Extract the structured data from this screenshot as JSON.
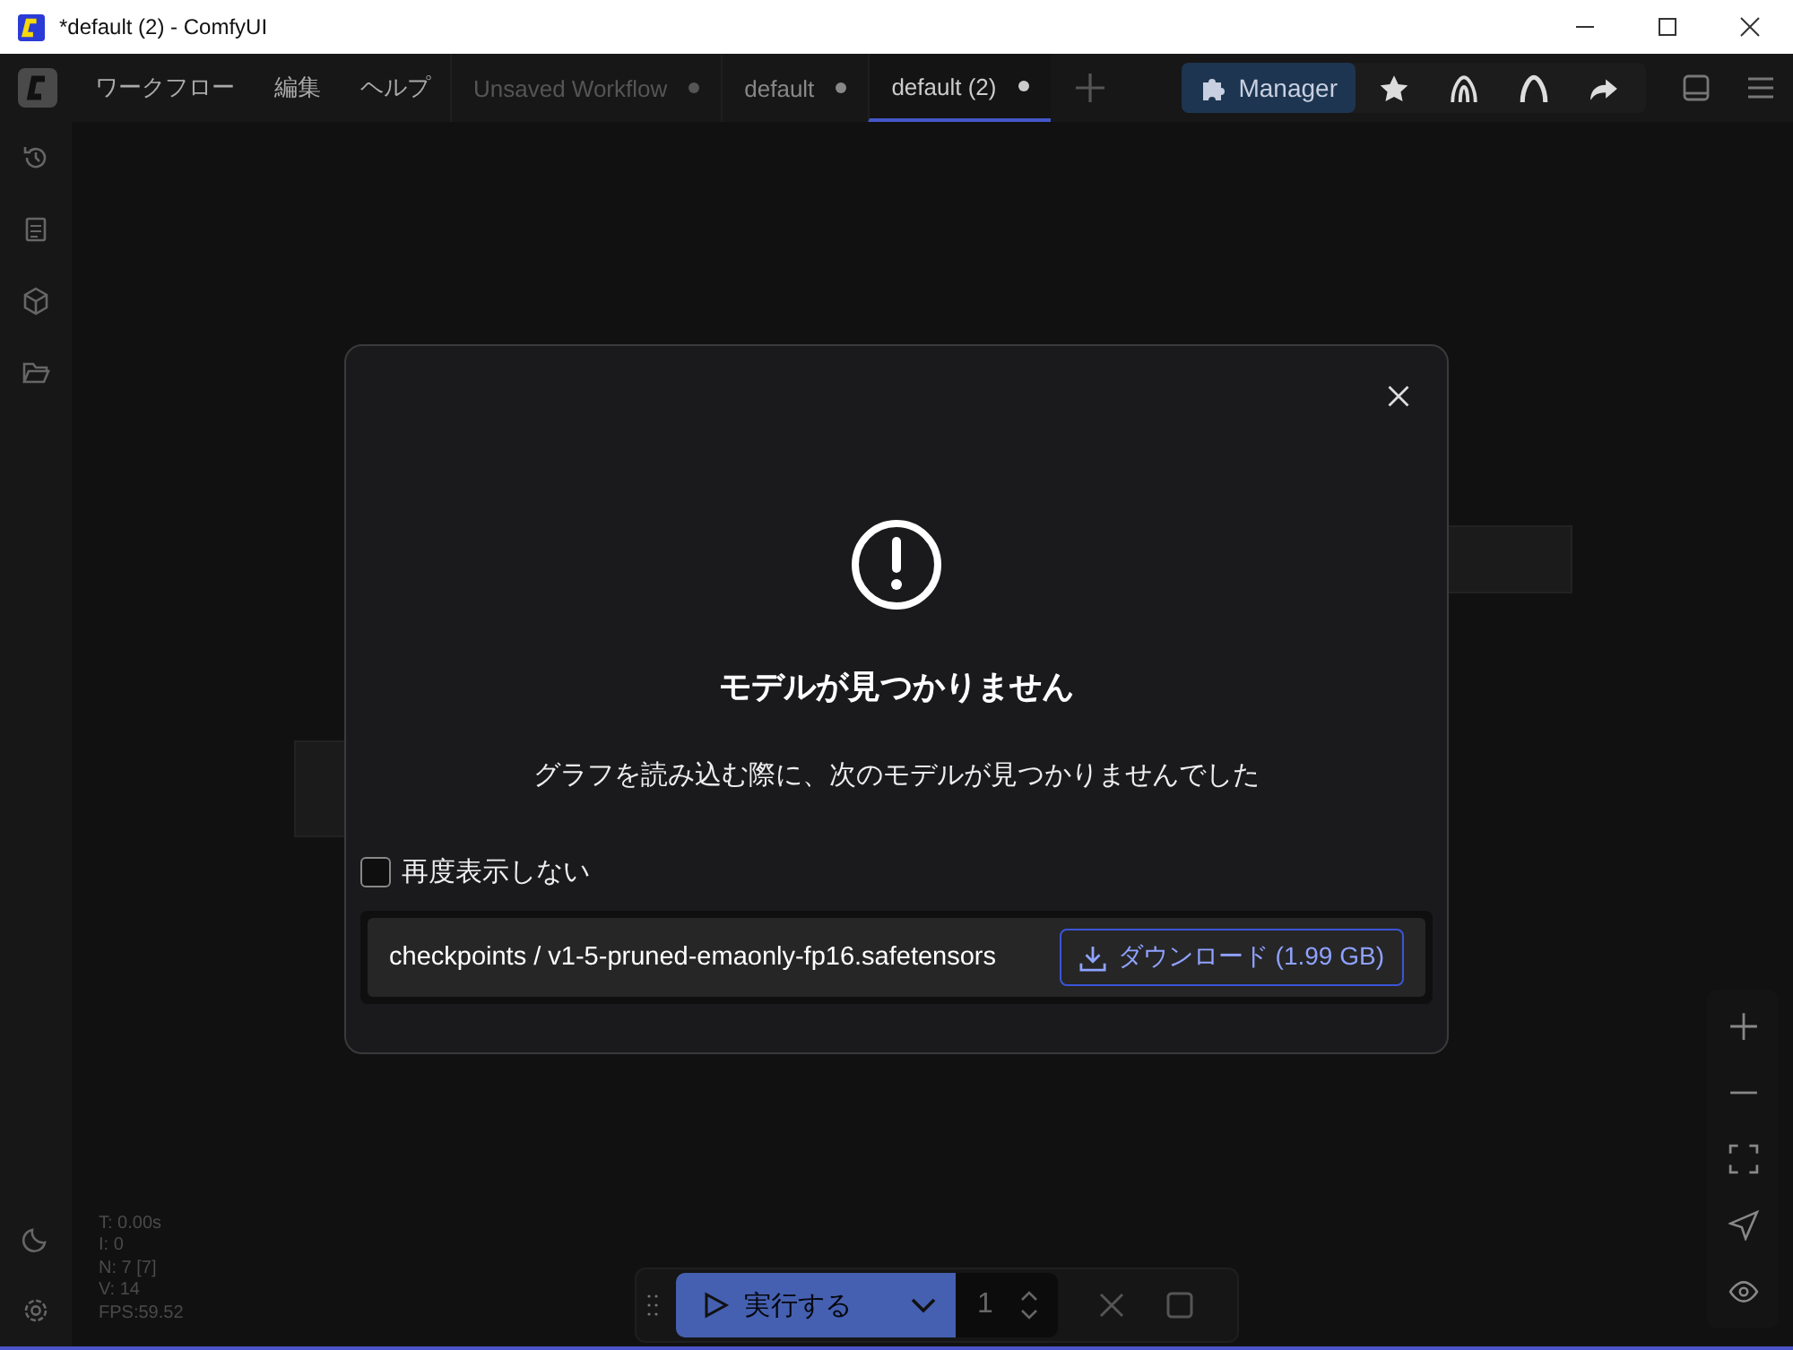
{
  "window": {
    "title": "*default (2) - ComfyUI"
  },
  "menu": [
    "ワークフロー",
    "編集",
    "ヘルプ"
  ],
  "tabs": [
    {
      "label": "Unsaved Workflow",
      "selected": false,
      "unsaved": true
    },
    {
      "label": "default",
      "selected": false,
      "unsaved": true
    },
    {
      "label": "default (2)",
      "selected": true,
      "unsaved": true
    }
  ],
  "manager": {
    "label": "Manager"
  },
  "dialog": {
    "title": "モデルが見つかりません",
    "message": "グラフを読み込む際に、次のモデルが見つかりませんでした",
    "dont_show_again": {
      "label": "再度表示しない",
      "checked": false
    },
    "models": [
      {
        "path": "checkpoints / v1-5-pruned-emaonly-fp16.safetensors",
        "download": "ダウンロード (1.99 GB)"
      }
    ]
  },
  "stats": [
    "T: 0.00s",
    "I: 0",
    "N: 7 [7]",
    "V: 14",
    "FPS:59.52"
  ],
  "run_bar": {
    "run_label": "実行する",
    "batch_count": "1"
  }
}
